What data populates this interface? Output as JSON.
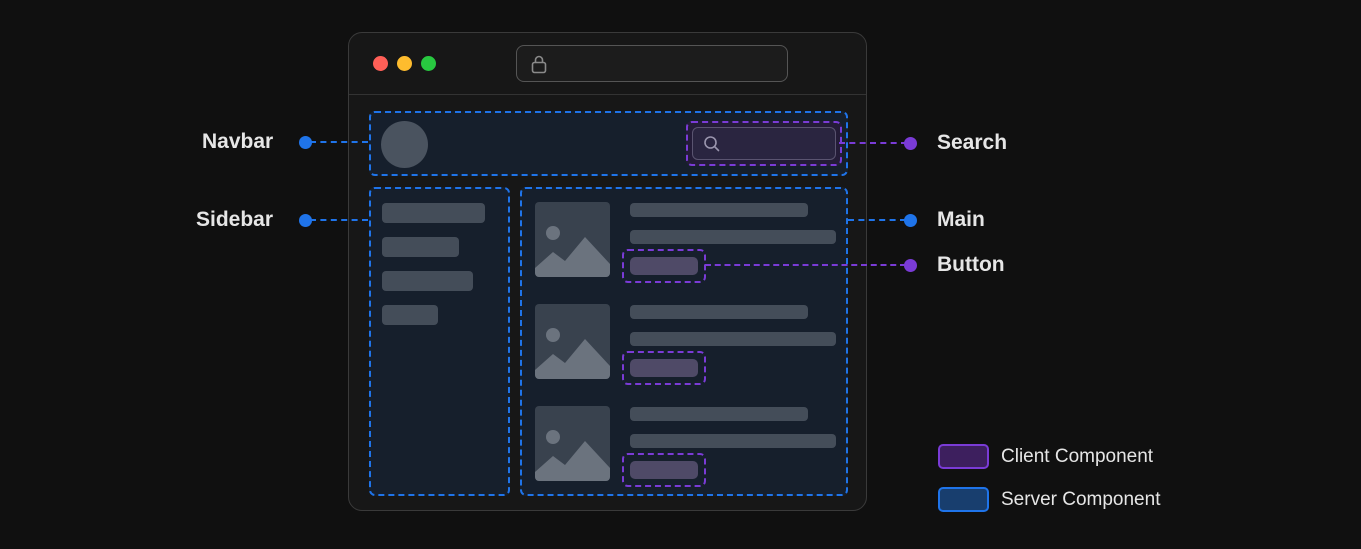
{
  "labels": {
    "navbar": "Navbar",
    "sidebar": "Sidebar",
    "search": "Search",
    "main": "Main",
    "button": "Button"
  },
  "legend": [
    {
      "label": "Client Component",
      "color": "#7a3bd6",
      "fill": "#3d1f5e"
    },
    {
      "label": "Server Component",
      "color": "#1f74ea",
      "fill": "#183e6e"
    }
  ],
  "colors": {
    "server": "#1f74ea",
    "client": "#7a3bd6",
    "traffic_red": "#ff5f57",
    "traffic_yellow": "#febc2e",
    "traffic_green": "#28c840"
  },
  "icons": {
    "url_lock": "lock-icon",
    "search": "search-icon",
    "thumbnail": "image-placeholder-icon"
  }
}
